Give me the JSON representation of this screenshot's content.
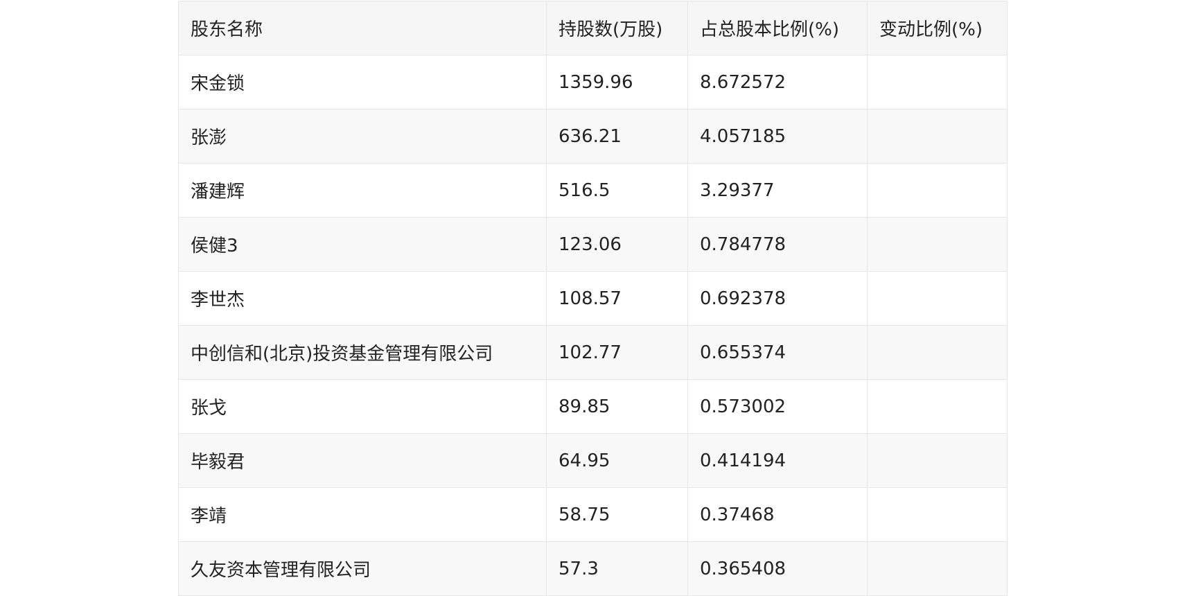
{
  "table": {
    "headers": [
      "股东名称",
      "持股数(万股)",
      "占总股本比例(%)",
      "变动比例(%)"
    ],
    "rows": [
      [
        "宋金锁",
        "1359.96",
        "8.672572",
        ""
      ],
      [
        "张澎",
        "636.21",
        "4.057185",
        ""
      ],
      [
        "潘建辉",
        "516.5",
        "3.29377",
        ""
      ],
      [
        "侯健3",
        "123.06",
        "0.784778",
        ""
      ],
      [
        "李世杰",
        "108.57",
        "0.692378",
        ""
      ],
      [
        "中创信和(北京)投资基金管理有限公司",
        "102.77",
        "0.655374",
        ""
      ],
      [
        "张戈",
        "89.85",
        "0.573002",
        ""
      ],
      [
        "毕毅君",
        "64.95",
        "0.414194",
        ""
      ],
      [
        "李靖",
        "58.75",
        "0.37468",
        ""
      ],
      [
        "久友资本管理有限公司",
        "57.3",
        "0.365408",
        ""
      ]
    ]
  }
}
